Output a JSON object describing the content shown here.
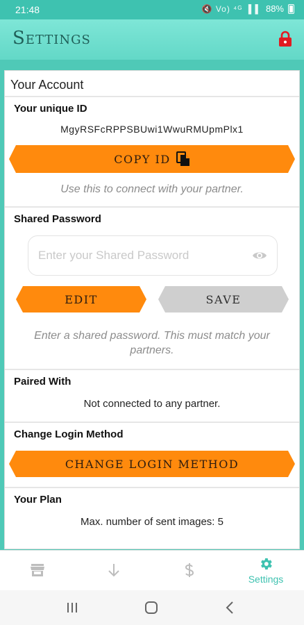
{
  "status": {
    "time": "21:48",
    "battery": "88%",
    "icons": "🔇 Vo) ⁴ᴳ ▐ ▌"
  },
  "app": {
    "title": "Settings"
  },
  "account": {
    "header": "Your Account",
    "unique_id_label": "Your unique ID",
    "unique_id_value": "MgyRSFcRPPSBUwi1WwuRMUpmPlx1",
    "copy_button_label": "COPY ID",
    "copy_hint": "Use this to connect with your partner."
  },
  "shared_password": {
    "label": "Shared Password",
    "placeholder": "Enter your Shared Password",
    "value": "",
    "edit_label": "EDIT",
    "save_label": "SAVE",
    "hint": "Enter a shared password. This must match your partners."
  },
  "paired": {
    "label": "Paired With",
    "status": "Not connected to any partner."
  },
  "login": {
    "label": "Change Login Method",
    "button_label": "CHANGE LOGIN METHOD"
  },
  "plan": {
    "label": "Your Plan",
    "detail": "Max. number of sent images: 5"
  },
  "bottom_nav": {
    "items": [
      {
        "icon": "store-icon"
      },
      {
        "icon": "download-icon"
      },
      {
        "icon": "dollar-icon"
      },
      {
        "icon": "gear-icon",
        "label": "Settings"
      }
    ],
    "active_color": "#3ec2b0"
  },
  "colors": {
    "accent": "#ff8a0d",
    "teal": "#4fc9b7",
    "lock": "#e11b22"
  }
}
